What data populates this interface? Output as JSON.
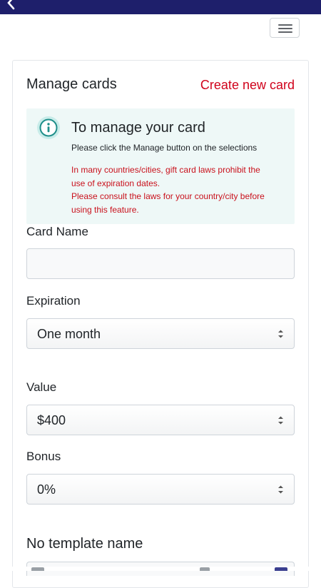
{
  "header": {
    "back_icon": "chevron-left-icon",
    "menu_icon": "hamburger-menu-icon"
  },
  "panel": {
    "title": "Manage cards",
    "create_link": "Create new card"
  },
  "info": {
    "icon": "info-circle-icon",
    "title": "To manage your card",
    "subtitle": "Please click the Manage button on the selections",
    "warning_lines": [
      "In many countries/cities, gift card laws prohibit the",
      "use of expiration dates.",
      "Please consult the laws for your country/city before",
      "using this feature."
    ]
  },
  "form": {
    "card_name": {
      "label": "Card Name",
      "value": "",
      "placeholder": ""
    },
    "expiration": {
      "label": "Expiration",
      "value": "One month"
    },
    "value": {
      "label": "Value",
      "value": "$400"
    },
    "bonus": {
      "label": "Bonus",
      "value": "0%"
    }
  },
  "template": {
    "title": "No template name"
  },
  "colors": {
    "header_bg": "#1e1f6b",
    "accent_red": "#d0021b",
    "info_bg": "#eef8f7",
    "info_icon": "#1f8f8a"
  }
}
